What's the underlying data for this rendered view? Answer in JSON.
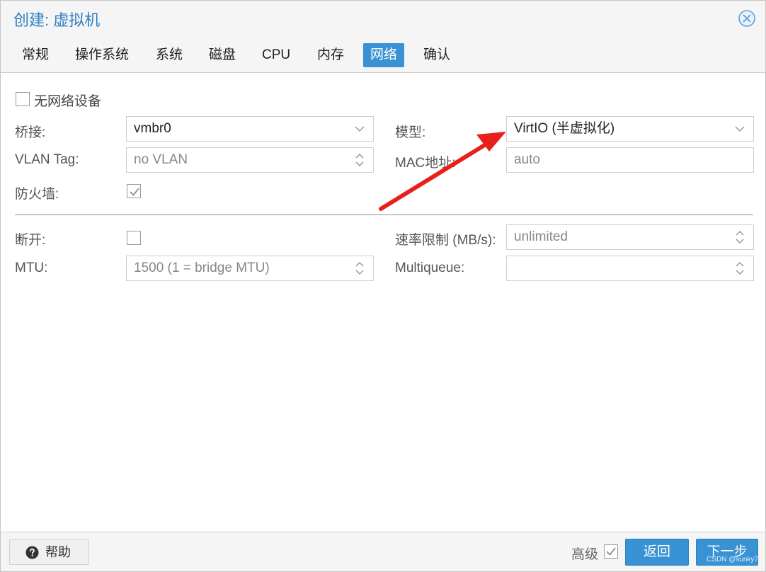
{
  "dialog": {
    "title": "创建: 虚拟机"
  },
  "tabs": [
    {
      "label": "常规",
      "active": false
    },
    {
      "label": "操作系统",
      "active": false
    },
    {
      "label": "系统",
      "active": false
    },
    {
      "label": "磁盘",
      "active": false
    },
    {
      "label": "CPU",
      "active": false
    },
    {
      "label": "内存",
      "active": false
    },
    {
      "label": "网络",
      "active": true
    },
    {
      "label": "确认",
      "active": false
    }
  ],
  "network": {
    "no_network_label": "无网络设备",
    "no_network_checked": false,
    "bridge_label": "桥接:",
    "bridge_value": "vmbr0",
    "vlan_label": "VLAN Tag:",
    "vlan_placeholder": "no VLAN",
    "firewall_label": "防火墙:",
    "firewall_checked": true,
    "model_label": "模型:",
    "model_value": "VirtIO (半虚拟化)",
    "mac_label": "MAC地址:",
    "mac_placeholder": "auto",
    "disconnect_label": "断开:",
    "disconnect_checked": false,
    "mtu_label": "MTU:",
    "mtu_placeholder": "1500 (1 = bridge MTU)",
    "rate_label": "速率限制 (MB/s):",
    "rate_placeholder": "unlimited",
    "multiqueue_label": "Multiqueue:",
    "multiqueue_value": ""
  },
  "footer": {
    "help_label": "帮助",
    "advanced_label": "高级",
    "advanced_checked": true,
    "back_label": "返回",
    "next_label": "下一步",
    "watermark": "CSDN @sunky7"
  },
  "colors": {
    "accent": "#3892d4",
    "title": "#2f7ec4",
    "arrow": "#e8201a"
  }
}
